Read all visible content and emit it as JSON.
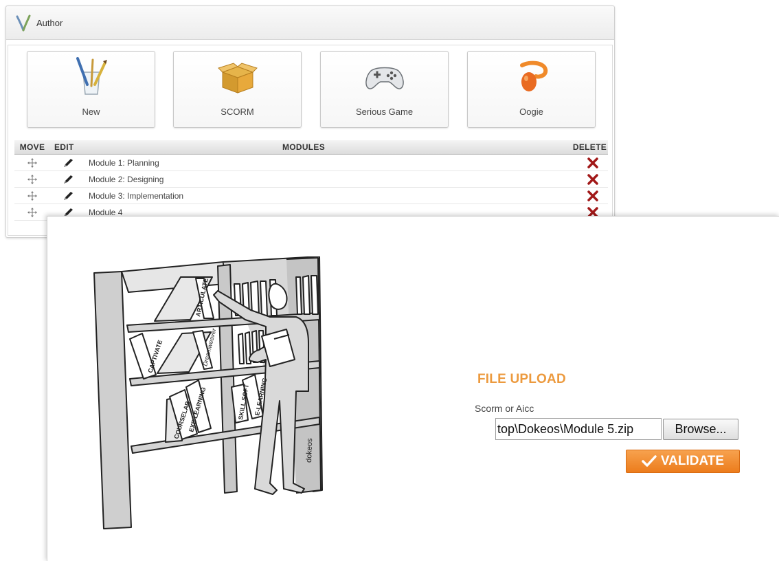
{
  "author": {
    "title": "Author",
    "tools": [
      {
        "label": "New",
        "icon": "pen-cup-icon"
      },
      {
        "label": "SCORM",
        "icon": "package-box-icon"
      },
      {
        "label": "Serious Game",
        "icon": "gamepad-icon"
      },
      {
        "label": "Oogie",
        "icon": "oogie-logo-icon"
      }
    ]
  },
  "modules_table": {
    "headers": {
      "move": "MOVE",
      "edit": "EDIT",
      "modules": "MODULES",
      "delete": "DELETE"
    },
    "rows": [
      {
        "name": "Module 1: Planning"
      },
      {
        "name": "Module 2: Designing"
      },
      {
        "name": "Module 3: Implementation"
      },
      {
        "name": "Module 4"
      }
    ]
  },
  "upload": {
    "title": "FILE UPLOAD",
    "label": "Scorm or Aicc",
    "file_value": "top\\Dokeos\\Module 5.zip",
    "browse_label": "Browse...",
    "validate_label": "VALIDATE"
  },
  "illustration": {
    "book_labels": [
      "ARTICULATE",
      "CAPTIVATE",
      "Dreamweaver",
      "COURSELAB",
      "EXE LEARNING",
      "SKILL SOFT",
      "E-LEARNING"
    ],
    "signature": "dokeos"
  },
  "colors": {
    "accent": "#ec9a3e",
    "validate": "#ec7c1c",
    "delete": "#a11818"
  }
}
